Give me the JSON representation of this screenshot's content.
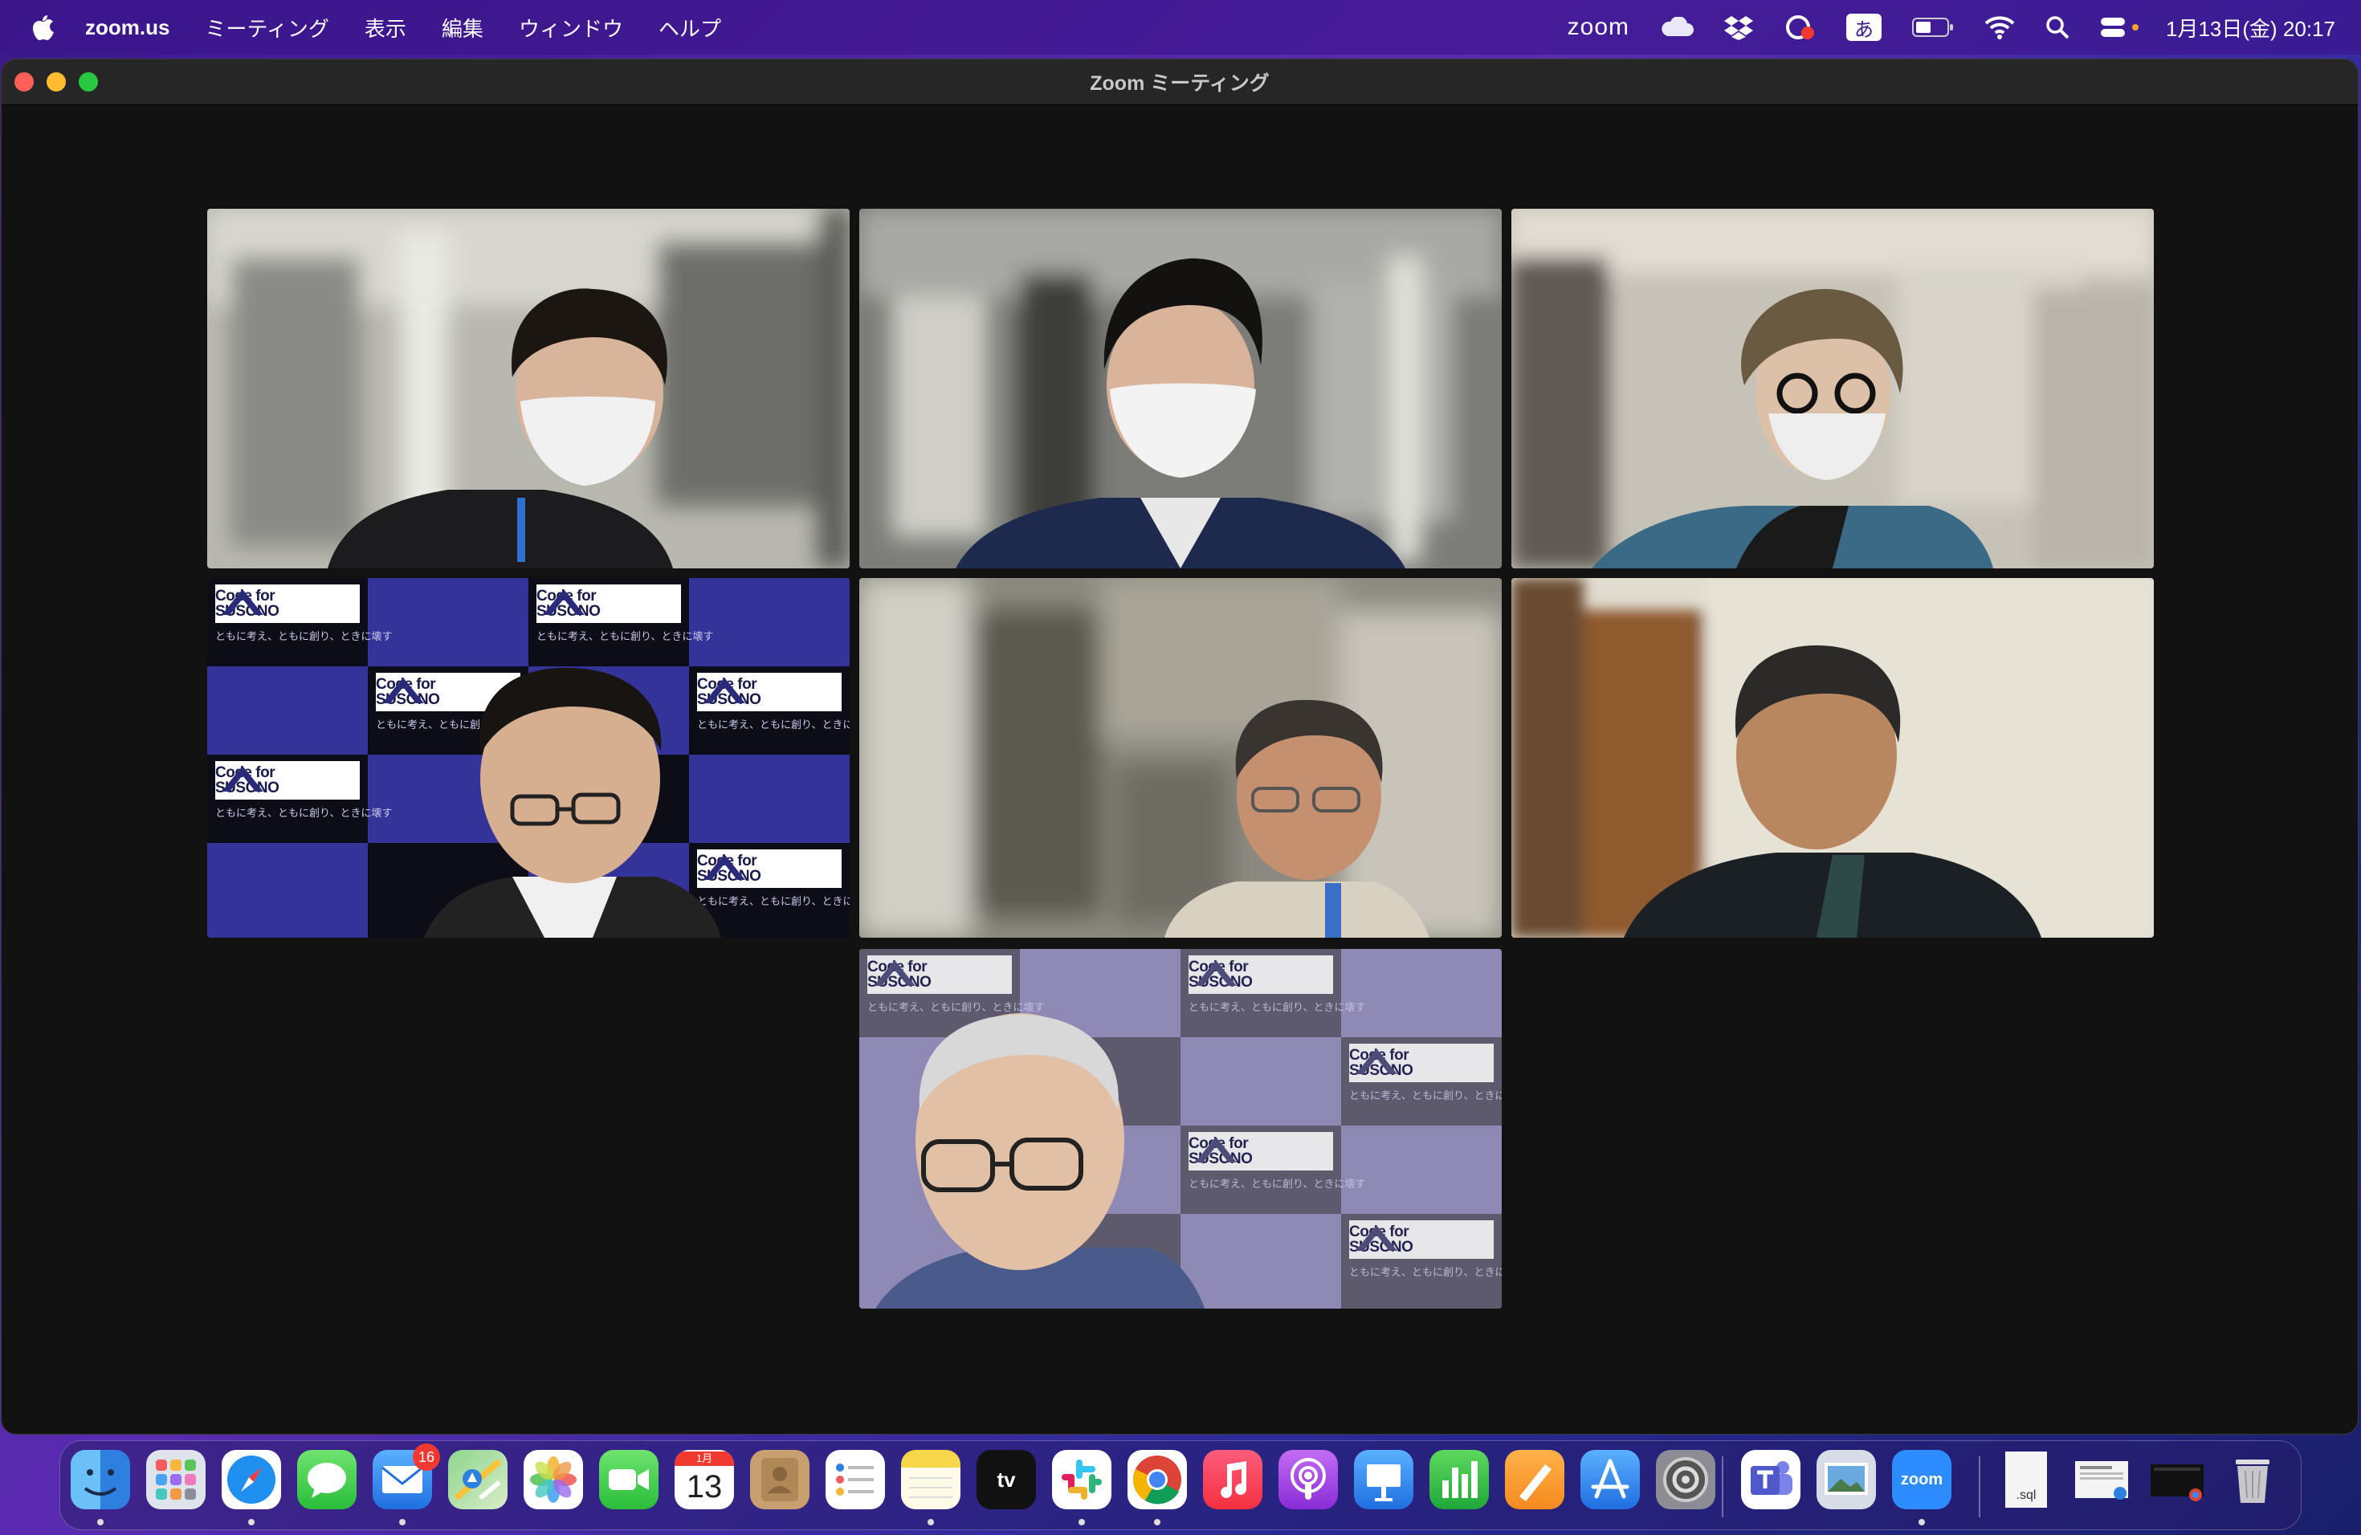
{
  "menubar": {
    "app_name": "zoom.us",
    "menus": [
      "ミーティング",
      "表示",
      "編集",
      "ウィンドウ",
      "ヘルプ"
    ],
    "zoom_tray_label": "zoom",
    "ime_label": "あ",
    "clock": "1月13日(金)  20:17",
    "battery_level": 0.5
  },
  "window": {
    "title": "Zoom ミーティング"
  },
  "participants": [
    {
      "id": "p1",
      "active_speaker": false,
      "background": "office"
    },
    {
      "id": "p2",
      "active_speaker": false,
      "background": "office"
    },
    {
      "id": "p3",
      "active_speaker": false,
      "background": "room"
    },
    {
      "id": "p4",
      "active_speaker": false,
      "background": "code-for-susono-board"
    },
    {
      "id": "p5",
      "active_speaker": true,
      "background": "room"
    },
    {
      "id": "p6",
      "active_speaker": false,
      "background": "room"
    },
    {
      "id": "p7",
      "active_speaker": false,
      "background": "code-for-susono-board-faded"
    }
  ],
  "virtual_background": {
    "logo_line1": "Code for",
    "logo_line2": "SUSONO",
    "tagline": "ともに考え、ともに創り、ときに壊す"
  },
  "dock": {
    "mail_badge": "16",
    "calendar_month": "1月",
    "calendar_day": "13",
    "tv_label": "tv",
    "zoom_label": "zoom",
    "sql_label": ".sql",
    "apps": [
      "finder",
      "launchpad",
      "safari",
      "messages",
      "mail",
      "maps",
      "photos",
      "facetime",
      "calendar",
      "contacts",
      "reminders",
      "notes",
      "apple-tv",
      "slack",
      "chrome",
      "music",
      "podcasts",
      "keynote",
      "numbers",
      "pages",
      "app-store",
      "system-settings",
      "teams",
      "preview",
      "zoom",
      "sql-file",
      "document",
      "screenshot",
      "trash"
    ]
  },
  "colors": {
    "menubar_bg": "#3c148c",
    "window_bg": "#121212",
    "active_border": "#4cd964",
    "board_blue": "#33339a",
    "board_faded": "#8f8ab5"
  }
}
